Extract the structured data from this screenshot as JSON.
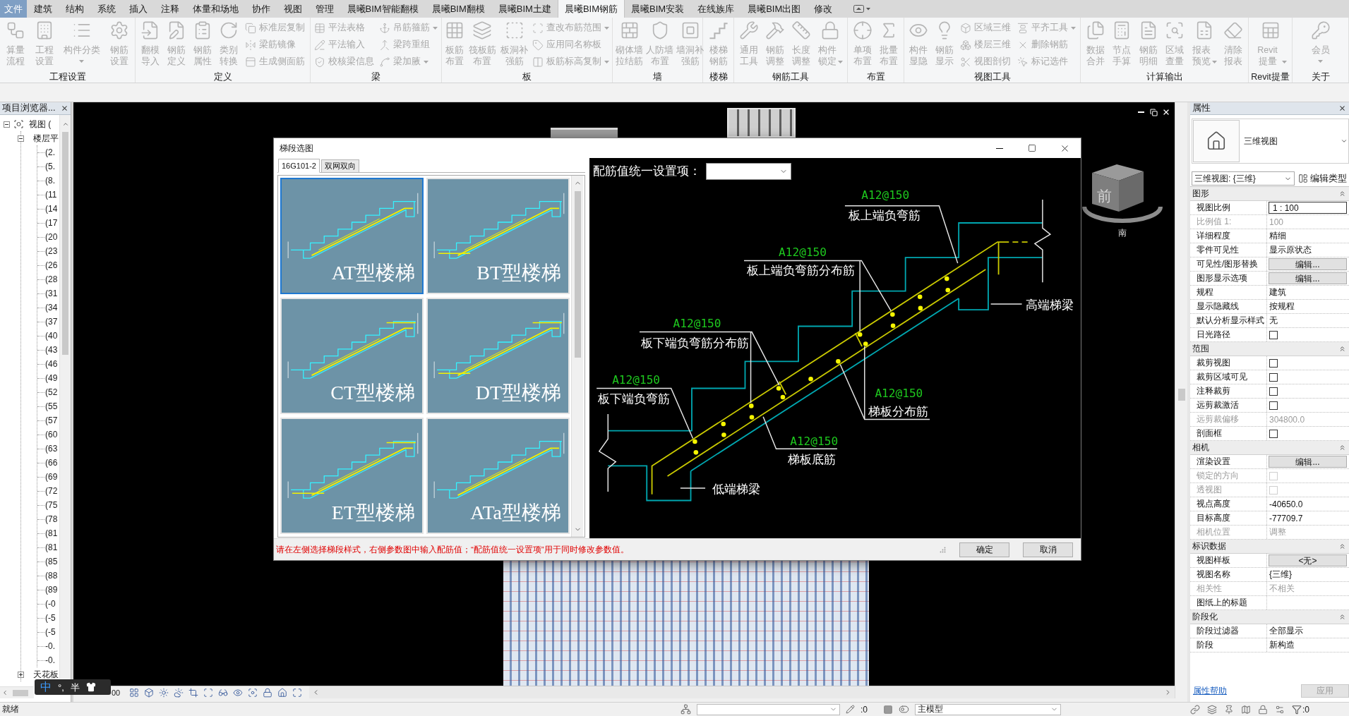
{
  "menu_tabs": [
    {
      "label": "文件",
      "kind": "file",
      "selected": false
    },
    {
      "label": "建筑",
      "kind": "tab",
      "selected": false
    },
    {
      "label": "结构",
      "kind": "tab",
      "selected": false
    },
    {
      "label": "系统",
      "kind": "tab",
      "selected": false
    },
    {
      "label": "插入",
      "kind": "tab",
      "selected": false
    },
    {
      "label": "注释",
      "kind": "tab",
      "selected": false
    },
    {
      "label": "体量和场地",
      "kind": "tab",
      "selected": false
    },
    {
      "label": "协作",
      "kind": "tab",
      "selected": false
    },
    {
      "label": "视图",
      "kind": "tab",
      "selected": false
    },
    {
      "label": "管理",
      "kind": "tab",
      "selected": false
    },
    {
      "label": "晨曦BIM智能翻模",
      "kind": "tab",
      "selected": false
    },
    {
      "label": "晨曦BIM翻模",
      "kind": "tab",
      "selected": false
    },
    {
      "label": "晨曦BIM土建",
      "kind": "tab",
      "selected": false
    },
    {
      "label": "晨曦BIM钢筋",
      "kind": "tab",
      "selected": true
    },
    {
      "label": "晨曦BIM安装",
      "kind": "tab",
      "selected": false
    },
    {
      "label": "在线族库",
      "kind": "tab",
      "selected": false
    },
    {
      "label": "晨曦BIM出图",
      "kind": "tab",
      "selected": false
    },
    {
      "label": "修改",
      "kind": "tab",
      "selected": false
    }
  ],
  "ribbon": {
    "disabled": true,
    "panels": [
      {
        "label": "工程设置",
        "buttons": [
          {
            "label": "算量流程",
            "kind": "large",
            "dropdown": false
          },
          {
            "label": "工程设置",
            "kind": "large",
            "dropdown": false
          },
          {
            "label": "构件分类",
            "kind": "short",
            "dropdown": true
          },
          {
            "label": "钢筋设置",
            "kind": "large",
            "dropdown": false
          }
        ]
      },
      {
        "label": "定义",
        "buttons": [
          {
            "label": "翻模导入",
            "kind": "large",
            "dropdown": false
          },
          {
            "label": "钢筋定义",
            "kind": "large",
            "dropdown": false
          },
          {
            "label": "钢筋属性",
            "kind": "large",
            "dropdown": false
          },
          {
            "label": "类别转换",
            "kind": "large",
            "dropdown": false
          },
          {
            "label": "标准层复制",
            "kind": "small",
            "dropdown": false
          },
          {
            "label": "梁筋镜像",
            "kind": "small",
            "dropdown": false
          },
          {
            "label": "生成侧面筋",
            "kind": "small",
            "dropdown": false
          }
        ]
      },
      {
        "label": "梁",
        "buttons": [
          {
            "label": "平法表格",
            "kind": "small",
            "dropdown": false
          },
          {
            "label": "平法输入",
            "kind": "small",
            "dropdown": false
          },
          {
            "label": "校核梁信息",
            "kind": "small",
            "dropdown": false
          },
          {
            "label": "吊筋箍筋",
            "kind": "small",
            "dropdown": true
          },
          {
            "label": "梁跨重组",
            "kind": "small",
            "dropdown": false
          },
          {
            "label": "梁加腋",
            "kind": "small",
            "dropdown": true
          }
        ]
      },
      {
        "label": "板",
        "buttons": [
          {
            "label": "板筋布置",
            "kind": "large",
            "dropdown": false
          },
          {
            "label": "筏板筋布置",
            "kind": "large",
            "dropdown": false
          },
          {
            "label": "板洞补强筋",
            "kind": "large",
            "dropdown": false
          },
          {
            "label": "查改布筋范围",
            "kind": "small",
            "dropdown": true
          },
          {
            "label": "应用同名称板",
            "kind": "small",
            "dropdown": false
          },
          {
            "label": "板筋标高复制",
            "kind": "small",
            "dropdown": true
          }
        ]
      },
      {
        "label": "墙",
        "buttons": [
          {
            "label": "砌体墙拉结筋",
            "kind": "large",
            "dropdown": false
          },
          {
            "label": "人防墙布置",
            "kind": "large",
            "dropdown": false
          },
          {
            "label": "墙洞补强筋",
            "kind": "large",
            "dropdown": false
          }
        ]
      },
      {
        "label": "楼梯",
        "buttons": [
          {
            "label": "楼梯钢筋",
            "kind": "large",
            "dropdown": false
          }
        ]
      },
      {
        "label": "钢筋工具",
        "buttons": [
          {
            "label": "通用工具",
            "kind": "large",
            "dropdown": false
          },
          {
            "label": "钢筋调整",
            "kind": "large",
            "dropdown": false
          },
          {
            "label": "长度调整",
            "kind": "large",
            "dropdown": false
          },
          {
            "label": "构件锁定",
            "kind": "large",
            "dropdown": true
          }
        ]
      },
      {
        "label": "布置",
        "buttons": [
          {
            "label": "单项布置",
            "kind": "large",
            "dropdown": false
          },
          {
            "label": "批量布置",
            "kind": "large",
            "dropdown": false
          }
        ]
      },
      {
        "label": "视图工具",
        "buttons": [
          {
            "label": "构件显隐",
            "kind": "large",
            "dropdown": false
          },
          {
            "label": "钢筋显示",
            "kind": "large",
            "dropdown": false
          },
          {
            "label": "区域三维",
            "kind": "small",
            "dropdown": false
          },
          {
            "label": "楼层三维",
            "kind": "small",
            "dropdown": false
          },
          {
            "label": "视图剖切",
            "kind": "small",
            "dropdown": false
          },
          {
            "label": "平齐工具",
            "kind": "small",
            "dropdown": true
          },
          {
            "label": "删除钢筋",
            "kind": "small",
            "dropdown": false
          },
          {
            "label": "标记选件",
            "kind": "small",
            "dropdown": false
          }
        ]
      },
      {
        "label": "计算输出",
        "buttons": [
          {
            "label": "数据合并",
            "kind": "large",
            "dropdown": false
          },
          {
            "label": "节点手算",
            "kind": "large",
            "dropdown": false
          },
          {
            "label": "钢筋明细",
            "kind": "large",
            "dropdown": false
          },
          {
            "label": "区域查量",
            "kind": "large",
            "dropdown": false
          },
          {
            "label": "报表预览",
            "kind": "large",
            "dropdown": true
          },
          {
            "label": "清除报表",
            "kind": "large",
            "dropdown": false
          }
        ]
      },
      {
        "label": "Revit提量",
        "buttons": [
          {
            "label": "Revit提量",
            "kind": "large",
            "dropdown": true
          }
        ]
      },
      {
        "label": "关于",
        "buttons": [
          {
            "label": "会员",
            "kind": "short",
            "dropdown": true
          }
        ]
      }
    ]
  },
  "project_browser": {
    "title": "项目浏览器...",
    "tree": [
      {
        "label": "视图 (",
        "expanded": true,
        "children": [
          {
            "label": "楼层平",
            "expanded": true,
            "children": [
              {
                "label": "(2."
              },
              {
                "label": "(5."
              },
              {
                "label": "(8."
              },
              {
                "label": "(11"
              },
              {
                "label": "(14"
              },
              {
                "label": "(17"
              },
              {
                "label": "(20"
              },
              {
                "label": "(23"
              },
              {
                "label": "(26"
              },
              {
                "label": "(28"
              },
              {
                "label": "(31"
              },
              {
                "label": "(34"
              },
              {
                "label": "(37"
              },
              {
                "label": "(40"
              },
              {
                "label": "(43"
              },
              {
                "label": "(46"
              },
              {
                "label": "(49"
              },
              {
                "label": "(52"
              },
              {
                "label": "(55"
              },
              {
                "label": "(57"
              },
              {
                "label": "(60"
              },
              {
                "label": "(63"
              },
              {
                "label": "(66"
              },
              {
                "label": "(69"
              },
              {
                "label": "(72"
              },
              {
                "label": "(75"
              },
              {
                "label": "(78"
              },
              {
                "label": "(81"
              },
              {
                "label": "(81"
              },
              {
                "label": "(85"
              },
              {
                "label": "(88"
              },
              {
                "label": "(89"
              },
              {
                "label": "(-0"
              },
              {
                "label": "(-5"
              },
              {
                "label": "(-5"
              },
              {
                "label": "-0."
              },
              {
                "label": "-0."
              }
            ]
          },
          {
            "label": "天花板",
            "expanded": false
          }
        ]
      }
    ]
  },
  "viewport": {
    "view_cube": {
      "face": "前",
      "compass": "南"
    },
    "view_bar": {
      "scale": "00"
    }
  },
  "dialog": {
    "title": "梯段选图",
    "tabs": [
      {
        "label": "16G101-2",
        "selected": true
      },
      {
        "label": "双网双向",
        "selected": false
      }
    ],
    "stair_types": [
      {
        "label": "AT型楼梯",
        "selected": true
      },
      {
        "label": "BT型楼梯",
        "selected": false
      },
      {
        "label": "CT型楼梯",
        "selected": false
      },
      {
        "label": "DT型楼梯",
        "selected": false
      },
      {
        "label": "ET型楼梯",
        "selected": false
      },
      {
        "label": "ATa型楼梯",
        "selected": false
      }
    ],
    "unified_setting": {
      "label": "配筋值统一设置项："
    },
    "rebar_labels": [
      {
        "value": "A12@150",
        "name": "板上端负弯筋"
      },
      {
        "value": "A12@150",
        "name": "板上端负弯筋分布筋"
      },
      {
        "value": "A12@150",
        "name": "板下端负弯筋分布筋"
      },
      {
        "value": "A12@150",
        "name": "板下端负弯筋"
      },
      {
        "value": "A12@150",
        "name": "梯板分布筋"
      },
      {
        "value": "A12@150",
        "name": "梯板底筋"
      }
    ],
    "beam_labels": [
      "高端梯梁",
      "低端梯梁"
    ],
    "hint": "请在左侧选择梯段样式，右侧参数图中输入配筋值；“配筋值统一设置项”用于同时修改参数值。",
    "buttons": [
      "确定",
      "取消"
    ]
  },
  "properties": {
    "title": "属性",
    "type_name": "三维视图",
    "view_selector": "三维视图: {三维}",
    "edit_type": "编辑类型",
    "sections": [
      {
        "label": "图形",
        "expanded": true,
        "rows": [
          {
            "label": "视图比例",
            "kind": "field",
            "value": "1 : 100",
            "disabled": false
          },
          {
            "label": "比例值 1:",
            "kind": "text",
            "value": "100",
            "disabled": true
          },
          {
            "label": "详细程度",
            "kind": "text",
            "value": "精细",
            "disabled": false
          },
          {
            "label": "零件可见性",
            "kind": "text",
            "value": "显示原状态",
            "disabled": false
          },
          {
            "label": "可见性/图形替换",
            "kind": "button",
            "value": "编辑...",
            "disabled": false
          },
          {
            "label": "图形显示选项",
            "kind": "button",
            "value": "编辑...",
            "disabled": false
          },
          {
            "label": "规程",
            "kind": "text",
            "value": "建筑",
            "disabled": false
          },
          {
            "label": "显示隐藏线",
            "kind": "text",
            "value": "按规程",
            "disabled": false
          },
          {
            "label": "默认分析显示样式",
            "kind": "text",
            "value": "无",
            "disabled": false
          },
          {
            "label": "日光路径",
            "kind": "checkbox",
            "checked": false,
            "disabled": false
          }
        ]
      },
      {
        "label": "范围",
        "expanded": true,
        "rows": [
          {
            "label": "裁剪视图",
            "kind": "checkbox",
            "checked": false,
            "disabled": false
          },
          {
            "label": "裁剪区域可见",
            "kind": "checkbox",
            "checked": false,
            "disabled": false
          },
          {
            "label": "注释裁剪",
            "kind": "checkbox",
            "checked": false,
            "disabled": false
          },
          {
            "label": "远剪裁激活",
            "kind": "checkbox",
            "checked": false,
            "disabled": false
          },
          {
            "label": "远剪裁偏移",
            "kind": "text",
            "value": "304800.0",
            "disabled": true
          },
          {
            "label": "剖面框",
            "kind": "checkbox",
            "checked": false,
            "disabled": false
          }
        ]
      },
      {
        "label": "相机",
        "expanded": true,
        "rows": [
          {
            "label": "渲染设置",
            "kind": "button",
            "value": "编辑...",
            "disabled": false
          },
          {
            "label": "锁定的方向",
            "kind": "checkbox",
            "checked": false,
            "disabled": true
          },
          {
            "label": "透视图",
            "kind": "checkbox",
            "checked": false,
            "disabled": true
          },
          {
            "label": "视点高度",
            "kind": "text",
            "value": "-40650.0",
            "disabled": false
          },
          {
            "label": "目标高度",
            "kind": "text",
            "value": "-77709.7",
            "disabled": false
          },
          {
            "label": "相机位置",
            "kind": "text",
            "value": "调整",
            "disabled": true
          }
        ]
      },
      {
        "label": "标识数据",
        "expanded": true,
        "rows": [
          {
            "label": "视图样板",
            "kind": "button",
            "value": "<无>",
            "disabled": false
          },
          {
            "label": "视图名称",
            "kind": "text",
            "value": "{三维}",
            "disabled": false
          },
          {
            "label": "相关性",
            "kind": "text",
            "value": "不相关",
            "disabled": true
          },
          {
            "label": "图纸上的标题",
            "kind": "text",
            "disabled": false
          }
        ]
      },
      {
        "label": "阶段化",
        "expanded": true,
        "rows": [
          {
            "label": "阶段过滤器",
            "kind": "text",
            "value": "全部显示",
            "disabled": false
          },
          {
            "label": "阶段",
            "kind": "text",
            "value": "新构造",
            "disabled": false
          }
        ]
      }
    ],
    "help_link": "属性帮助",
    "apply": {
      "label": "应用",
      "disabled": true
    }
  },
  "ime_toolbar": {
    "items": [
      "中",
      "°,",
      "半"
    ]
  },
  "status_bar": {
    "text": "就绪",
    "workset_count": ":0",
    "model": "主模型",
    "filter_count": ":0"
  }
}
